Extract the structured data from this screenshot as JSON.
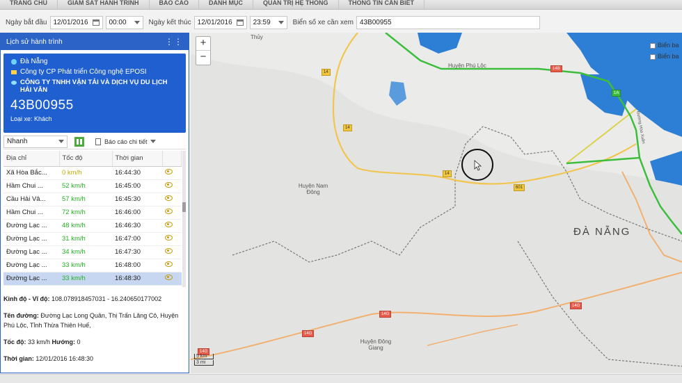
{
  "nav": [
    "Trang chủ",
    "Giám sát hành trình",
    "Báo cáo",
    "Danh mục",
    "Quản trị hệ thống",
    "Thông tin cần biết"
  ],
  "filter": {
    "start_label": "Ngày bắt đầu",
    "start_date": "12/01/2016",
    "start_time": "00:00",
    "end_label": "Ngày kết thúc",
    "end_date": "12/01/2016",
    "end_time": "23:59",
    "plate_label": "Biển số xe cần xem",
    "plate_value": "43B00955"
  },
  "panel": {
    "title": "Lịch sử hành trình",
    "region": "Đà Nẵng",
    "provider": "Công ty CP Phát triển Công nghệ EPOSI",
    "company": "CÔNG TY TNHH VẬN TẢI VÀ DỊCH VỤ DU LỊCH HẢI VÂN",
    "plate": "43B00955",
    "vehicle_type": "Loại xe: Khách",
    "speed_select": "Nhanh",
    "report_label": "Báo cáo chi tiết"
  },
  "table": {
    "headers": [
      "Địa chỉ",
      "Tốc độ",
      "Thời gian",
      ""
    ],
    "rows": [
      {
        "addr": "Xã Hòa Bắc...",
        "speed": "0 km/h",
        "time": "16:44:30",
        "color": "#c4a800"
      },
      {
        "addr": "Hầm Chui ...",
        "speed": "52 km/h",
        "time": "16:45:00",
        "color": "#22b322"
      },
      {
        "addr": "Cầu Hải Vâ...",
        "speed": "57 km/h",
        "time": "16:45:30",
        "color": "#22b322"
      },
      {
        "addr": "Hầm Chui ...",
        "speed": "72 km/h",
        "time": "16:46:00",
        "color": "#22b322"
      },
      {
        "addr": "Đường Lạc ...",
        "speed": "48 km/h",
        "time": "16:46:30",
        "color": "#22b322"
      },
      {
        "addr": "Đường Lạc ...",
        "speed": "31 km/h",
        "time": "16:47:00",
        "color": "#22b322"
      },
      {
        "addr": "Đường Lạc ...",
        "speed": "34 km/h",
        "time": "16:47:30",
        "color": "#22b322"
      },
      {
        "addr": "Đường Lạc ...",
        "speed": "33 km/h",
        "time": "16:48:00",
        "color": "#22b322"
      },
      {
        "addr": "Đường Lạc ...",
        "speed": "33 km/h",
        "time": "16:48:30",
        "color": "#22b322"
      }
    ]
  },
  "info": {
    "coord_label": "Kinh độ - Vĩ độ:",
    "coord_value": "108.078918457031 - 16.240650177002",
    "street_label": "Tên đường:",
    "street_value": "Đường Lạc Long Quân, Thị Trấn Lăng Cô, Huyện Phú Lộc, Tỉnh Thừa Thiên Huế,",
    "speed_label": "Tốc độ:",
    "speed_value": "33 km/h",
    "heading_label": "Hướng:",
    "heading_value": "0",
    "time_label": "Thời gian:",
    "time_value": "12/01/2016 16:48:30"
  },
  "map": {
    "zoom_in": "+",
    "zoom_out": "−",
    "legend": [
      "Biển ba",
      "Biển ba"
    ],
    "labels": {
      "thuy": "Thủy",
      "phu_loc": "Huyện Phú Lộc",
      "nam_dong": "Huyện Nam Đông",
      "dong_giang": "Huyện Đông Giang",
      "da_nang": "ĐÀ NẴNG",
      "road": "Đường Hòa Xuân"
    },
    "shields": {
      "r14a": "14",
      "r14b": "14",
      "r14c": "14",
      "r14g1": "14G",
      "r14g2": "14G",
      "r14g3": "14G",
      "r14g4": "14G",
      "r601": "601",
      "r14b2": "14B",
      "rAH": "1A"
    },
    "scale_km": "5 km",
    "scale_mi": "3 mi"
  },
  "colors": {
    "panel_blue": "#2c63c6",
    "route_green": "#3cbe3c",
    "route_yellow": "#dcd04a",
    "water": "#2d7fd6"
  }
}
